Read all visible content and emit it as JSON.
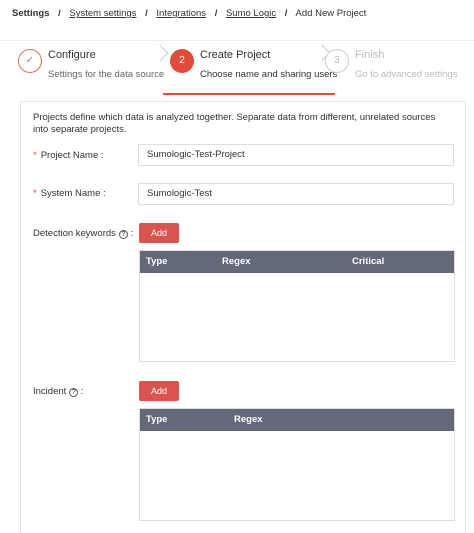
{
  "breadcrumb": {
    "root": "Settings",
    "items": [
      "System settings",
      "Integrations",
      "Sumo Logic"
    ],
    "current": "Add New Project",
    "separator": "/"
  },
  "steps": [
    {
      "number": "✓",
      "title": "Configure",
      "subtitle": "Settings for the data source",
      "state": "done"
    },
    {
      "number": "2",
      "title": "Create Project",
      "subtitle": "Choose name and sharing users",
      "state": "active"
    },
    {
      "number": "3",
      "title": "Finish",
      "subtitle": "Go to advanced settings",
      "state": "pending"
    }
  ],
  "form": {
    "description": "Projects define which data is analyzed together. Separate data from different, unrelated sources into separate projects.",
    "project_name": {
      "required_mark": "*",
      "label": "Project Name",
      "colon": ":",
      "value": "Sumologic-Test-Project"
    },
    "system_name": {
      "required_mark": "*",
      "label": "System Name",
      "colon": ":",
      "value": "Sumologic-Test"
    },
    "detection_keywords": {
      "label": "Detection keywords",
      "colon": ":",
      "help_icon": "question-circle-icon",
      "add_label": "Add",
      "columns": [
        "Type",
        "Regex",
        "Critical"
      ]
    },
    "incident": {
      "label": "Incident",
      "colon": ":",
      "help_icon": "question-circle-icon",
      "add_label": "Add",
      "columns": [
        "Type",
        "Regex"
      ]
    }
  },
  "colors": {
    "accent": "#e04b3a",
    "button": "#d9534f",
    "table_header": "#636979"
  }
}
